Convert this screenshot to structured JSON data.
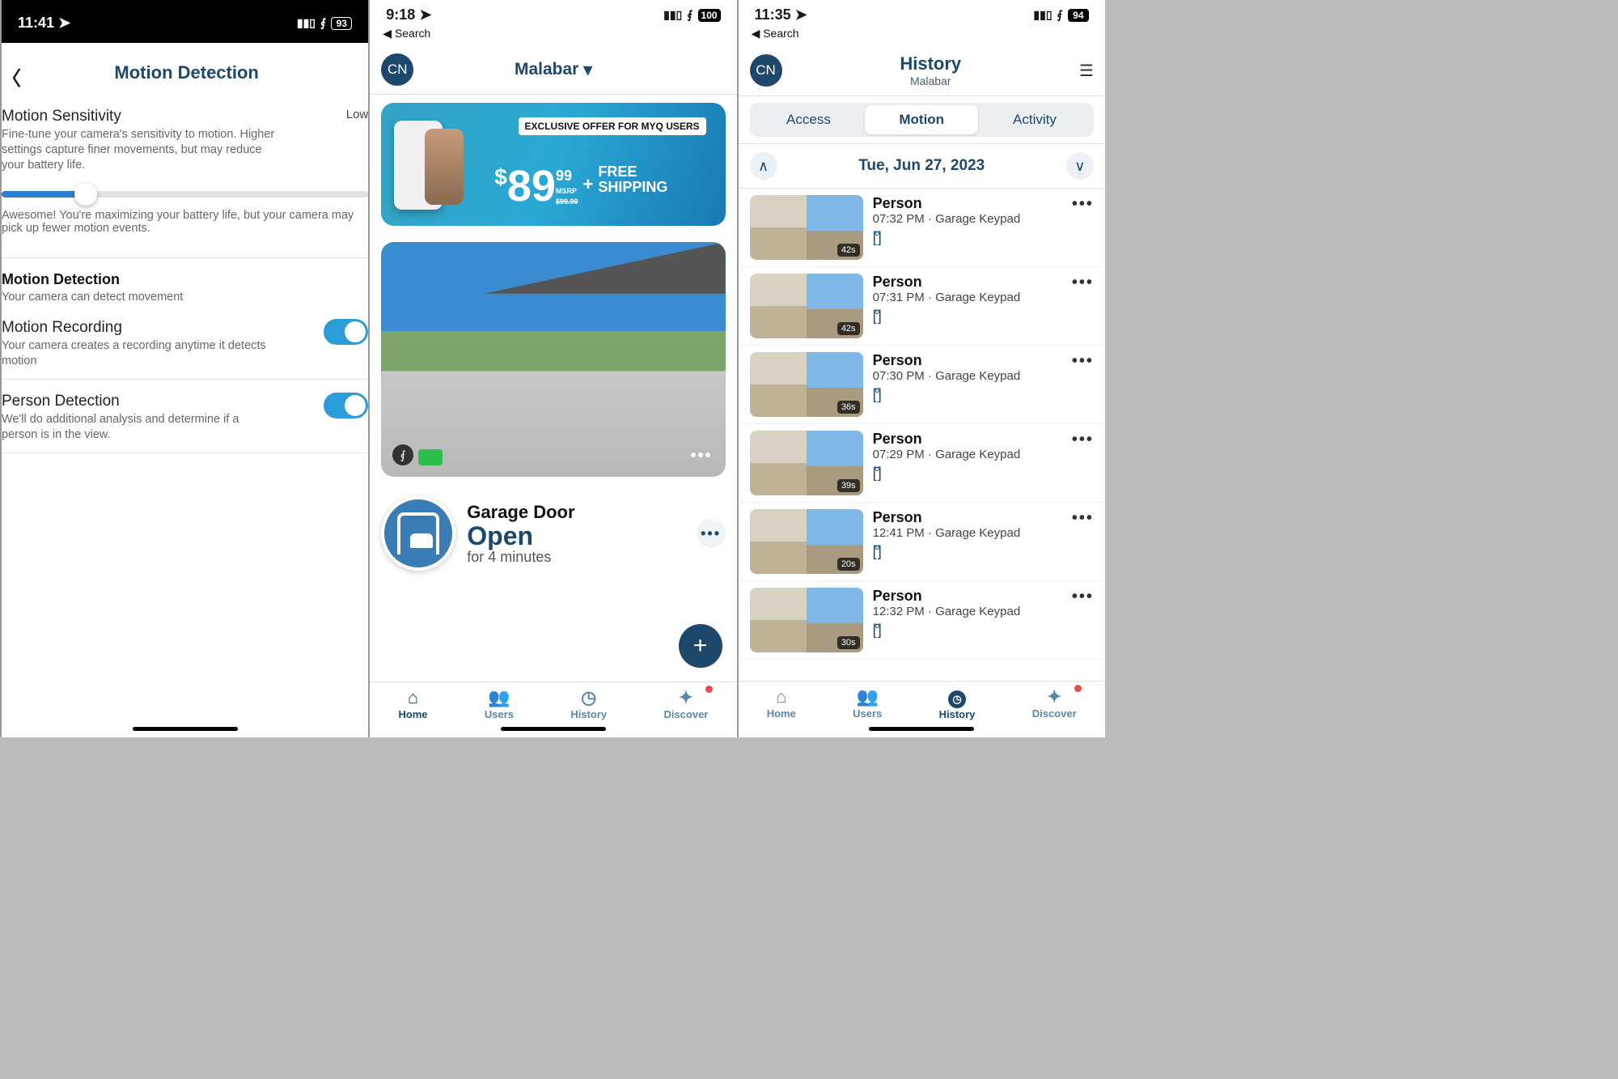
{
  "screen1": {
    "status": {
      "time": "11:41",
      "battery": "93"
    },
    "title": "Motion Detection",
    "sensitivity": {
      "label": "Motion Sensitivity",
      "value": "Low",
      "desc": "Fine-tune your camera's sensitivity to motion. Higher settings capture finer movements, but may reduce your battery life.",
      "hint": "Awesome! You're maximizing your battery life, but your camera may pick up fewer motion events."
    },
    "detection": {
      "label": "Motion Detection",
      "desc": "Your camera can detect movement"
    },
    "recording": {
      "label": "Motion Recording",
      "desc": "Your camera creates a recording anytime it detects motion"
    },
    "person": {
      "label": "Person Detection",
      "desc": "We'll do additional analysis and determine if a person is in the view."
    }
  },
  "screen2": {
    "status": {
      "time": "9:18",
      "battery": "100"
    },
    "back": "Search",
    "avatar": "CN",
    "location": "Malabar",
    "promo": {
      "tag": "EXCLUSIVE OFFER FOR MYQ USERS",
      "dollar": "$",
      "price": "89",
      "cents": "99",
      "msrp": "MSRP",
      "msrp_val": "$99.99",
      "plus": "+",
      "free": "FREE",
      "ship": "SHIPPING"
    },
    "device": {
      "name": "Garage Door",
      "state": "Open",
      "time": "for 4 minutes"
    },
    "tabs": {
      "home": "Home",
      "users": "Users",
      "history": "History",
      "discover": "Discover"
    }
  },
  "screen3": {
    "status": {
      "time": "11:35",
      "battery": "94"
    },
    "back": "Search",
    "avatar": "CN",
    "title": "History",
    "subtitle": "Malabar",
    "segments": {
      "access": "Access",
      "motion": "Motion",
      "activity": "Activity"
    },
    "date": "Tue, Jun 27, 2023",
    "events": [
      {
        "title": "Person",
        "time": "07:32 PM",
        "src": "Garage Keypad",
        "dur": "42s"
      },
      {
        "title": "Person",
        "time": "07:31 PM",
        "src": "Garage Keypad",
        "dur": "42s"
      },
      {
        "title": "Person",
        "time": "07:30 PM",
        "src": "Garage Keypad",
        "dur": "36s"
      },
      {
        "title": "Person",
        "time": "07:29 PM",
        "src": "Garage Keypad",
        "dur": "39s"
      },
      {
        "title": "Person",
        "time": "12:41 PM",
        "src": "Garage Keypad",
        "dur": "20s"
      },
      {
        "title": "Person",
        "time": "12:32 PM",
        "src": "Garage Keypad",
        "dur": "30s"
      }
    ],
    "tabs": {
      "home": "Home",
      "users": "Users",
      "history": "History",
      "discover": "Discover"
    }
  }
}
